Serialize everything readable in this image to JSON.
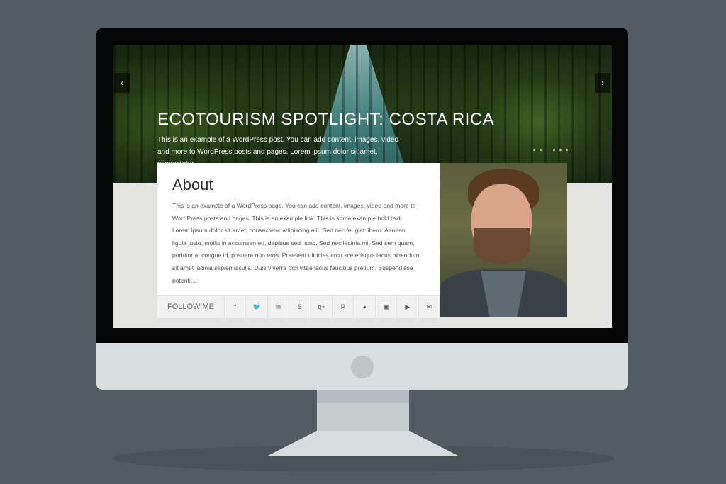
{
  "hero": {
    "title": "ECOTOURISM SPOTLIGHT: COSTA RICA",
    "excerpt": "This is an example of a WordPress post. You can add content, images, video and more to WordPress posts and pages. Lorem ipsum dolor sit amet, consectetur...",
    "prev_icon": "chevron-left-icon",
    "next_icon": "chevron-right-icon"
  },
  "about": {
    "title": "About",
    "text": "This is an example of a WordPress page. You can add content, images, video and more to WordPress posts and pages. This is an example link. This is some example bold text. Lorem ipsum dolor sit amet, consectetur adipiscing elit. Sed nec feugiat libero. Aenean ligula justo, mollis in accumsan eu, dapibus sed nunc. Sed nec lacinia mi. Sed sem quam, porttitor at congue id, posuere non eros. Praesent ultricies arcu scelerisque lacus bibendum sit amet lacinia sapien iaculis. Duis viverra orci vitae lacus faucibus pretium. Suspendisse potenti...."
  },
  "social": {
    "follow_label": "FOLLOW ME",
    "icons": [
      {
        "name": "facebook-icon",
        "glyph": "f"
      },
      {
        "name": "twitter-icon",
        "glyph": "🐦"
      },
      {
        "name": "linkedin-icon",
        "glyph": "in"
      },
      {
        "name": "skype-icon",
        "glyph": "S"
      },
      {
        "name": "google-plus-icon",
        "glyph": "g+"
      },
      {
        "name": "pinterest-icon",
        "glyph": "P"
      },
      {
        "name": "github-icon",
        "glyph": "◕"
      },
      {
        "name": "instagram-icon",
        "glyph": "▣"
      },
      {
        "name": "youtube-icon",
        "glyph": "▶"
      },
      {
        "name": "email-icon",
        "glyph": "✉"
      }
    ]
  }
}
